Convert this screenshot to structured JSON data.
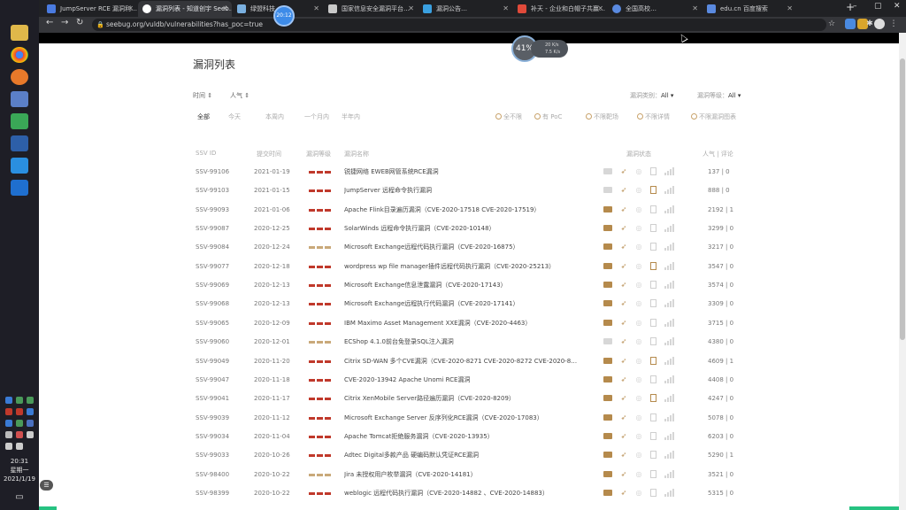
{
  "taskbar": {
    "clock_time": "20:31",
    "clock_weekday": "星期一",
    "clock_date": "2021/1/19"
  },
  "browser": {
    "tabs": [
      {
        "label": "JumpServer RCE 漏洞利…",
        "active": false
      },
      {
        "label": "漏洞列表 - 知道创宇 Seeb…",
        "active": true
      },
      {
        "label": "绿盟科技…",
        "active": false
      },
      {
        "label": "国家信息安全漏洞平台…",
        "active": false
      },
      {
        "label": "漏洞公告…",
        "active": false
      },
      {
        "label": "补天 - 企业和白帽子共赢…",
        "active": false
      },
      {
        "label": "全国高校…",
        "active": false
      },
      {
        "label": "edu.cn 百度搜索",
        "active": false
      }
    ],
    "url": "seebug.org/vuldb/vulnerabilities?has_poc=true"
  },
  "overlays": {
    "timer_badge": "20:12",
    "speed_percent": "41%",
    "speed_up": "20 K/s",
    "speed_down": "7.5 K/s"
  },
  "page": {
    "title": "漏洞列表",
    "sort_time": "时间 ⇕",
    "sort_popular": "人气 ⇕",
    "filter_category_label": "漏洞类别：",
    "filter_category_value": "All ▾",
    "filter_level_label": "漏洞等级：",
    "filter_level_value": "All ▾",
    "periods": [
      "全部",
      "今天",
      "本周内",
      "一个月内",
      "半年内"
    ],
    "radios": [
      "全不限",
      "有 PoC",
      "不限靶场",
      "不限详情",
      "不限漏洞图表"
    ],
    "headers": {
      "ssvid": "SSV ID",
      "date": "提交时间",
      "level": "漏洞等级",
      "name": "漏洞名称",
      "status": "漏洞状态",
      "stats": "人气 | 评论"
    }
  },
  "rows": [
    {
      "ssvid": "SSV-99106",
      "date": "2021-01-19",
      "severity": "high",
      "name": "锐捷网络 EWEB网管系统RCE漏洞",
      "stats": "137 | 0",
      "card": false,
      "doc": false
    },
    {
      "ssvid": "SSV-99103",
      "date": "2021-01-15",
      "severity": "high",
      "name": "JumpServer 远程命令执行漏洞",
      "stats": "888 | 0",
      "card": false,
      "doc": true
    },
    {
      "ssvid": "SSV-99093",
      "date": "2021-01-06",
      "severity": "high",
      "name": "Apache Flink目录遍历漏洞（CVE-2020-17518 CVE-2020-17519）",
      "stats": "2192 | 1",
      "card": true,
      "doc": false
    },
    {
      "ssvid": "SSV-99087",
      "date": "2020-12-25",
      "severity": "high",
      "name": "SolarWinds 远程命令执行漏洞（CVE-2020-10148）",
      "stats": "3299 | 0",
      "card": true,
      "doc": false
    },
    {
      "ssvid": "SSV-99084",
      "date": "2020-12-24",
      "severity": "med",
      "name": "Microsoft Exchange远程代码执行漏洞（CVE-2020-16875）",
      "stats": "3217 | 0",
      "card": true,
      "doc": false
    },
    {
      "ssvid": "SSV-99077",
      "date": "2020-12-18",
      "severity": "high",
      "name": "wordpress wp file manager插件远程代码执行漏洞（CVE-2020-25213）",
      "stats": "3547 | 0",
      "card": true,
      "doc": true
    },
    {
      "ssvid": "SSV-99069",
      "date": "2020-12-13",
      "severity": "high",
      "name": "Microsoft Exchange信息泄露漏洞（CVE-2020-17143）",
      "stats": "3574 | 0",
      "card": true,
      "doc": false
    },
    {
      "ssvid": "SSV-99068",
      "date": "2020-12-13",
      "severity": "high",
      "name": "Microsoft Exchange远程执行代码漏洞（CVE-2020-17141）",
      "stats": "3309 | 0",
      "card": true,
      "doc": false
    },
    {
      "ssvid": "SSV-99065",
      "date": "2020-12-09",
      "severity": "high",
      "name": "IBM Maximo Asset Management XXE漏洞（CVE-2020-4463）",
      "stats": "3715 | 0",
      "card": true,
      "doc": false
    },
    {
      "ssvid": "SSV-99060",
      "date": "2020-12-01",
      "severity": "med",
      "name": "ECShop 4.1.0前台免登录SQL注入漏洞",
      "stats": "4380 | 0",
      "card": false,
      "doc": false
    },
    {
      "ssvid": "SSV-99049",
      "date": "2020-11-20",
      "severity": "high",
      "name": "Citrix SD-WAN 多个CVE漏洞（CVE-2020-8271 CVE-2020-8272 CVE-2020-8…",
      "stats": "4609 | 1",
      "card": true,
      "doc": true
    },
    {
      "ssvid": "SSV-99047",
      "date": "2020-11-18",
      "severity": "high",
      "name": "CVE-2020-13942 Apache Unomi RCE漏洞",
      "stats": "4408 | 0",
      "card": true,
      "doc": false
    },
    {
      "ssvid": "SSV-99041",
      "date": "2020-11-17",
      "severity": "high",
      "name": "Citrix XenMobile Server路径遍历漏洞（CVE-2020-8209）",
      "stats": "4247 | 0",
      "card": true,
      "doc": true
    },
    {
      "ssvid": "SSV-99039",
      "date": "2020-11-12",
      "severity": "high",
      "name": "Microsoft Exchange Server 反序列化RCE漏洞（CVE-2020-17083）",
      "stats": "5078 | 0",
      "card": true,
      "doc": false
    },
    {
      "ssvid": "SSV-99034",
      "date": "2020-11-04",
      "severity": "high",
      "name": "Apache Tomcat拒绝服务漏洞（CVE-2020-13935）",
      "stats": "6203 | 0",
      "card": true,
      "doc": false
    },
    {
      "ssvid": "SSV-99033",
      "date": "2020-10-26",
      "severity": "high",
      "name": "Adtec Digital多款产品 硬编码默认凭证RCE漏洞",
      "stats": "5290 | 1",
      "card": true,
      "doc": false
    },
    {
      "ssvid": "SSV-98400",
      "date": "2020-10-22",
      "severity": "med",
      "name": "Jira 未授权用户枚举漏洞（CVE-2020-14181）",
      "stats": "3521 | 0",
      "card": true,
      "doc": false
    },
    {
      "ssvid": "SSV-98399",
      "date": "2020-10-22",
      "severity": "high",
      "name": "weblogic 远程代码执行漏洞（CVE-2020-14882 、CVE-2020-14883）",
      "stats": "5315 | 0",
      "card": true,
      "doc": false
    }
  ],
  "colors": {
    "severity_high": "#c0392b",
    "severity_med": "#c9a97a",
    "status_on": "#b58a4c",
    "accent_green": "#26c281"
  }
}
